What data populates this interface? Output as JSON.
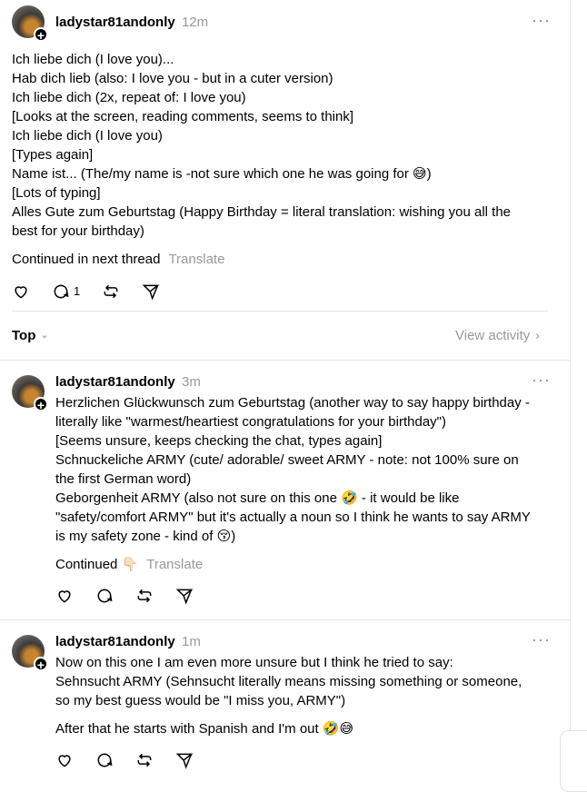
{
  "post": {
    "username": "ladystar81andonly",
    "time": "12m",
    "lines": [
      "Ich liebe dich (I love you)...",
      "Hab dich lieb (also: I love you - but in a cuter version)",
      "Ich liebe dich (2x, repeat of: I love you)",
      "[Looks at the screen, reading comments, seems to think]",
      "Ich liebe dich (I love you)",
      "[Types again]",
      "Name ist... (The/my name is -not sure which one he was going for 😅)",
      "[Lots of typing]",
      "Alles Gute zum Geburtstag (Happy Birthday = literal translation: wishing you all the",
      "best for your birthday)"
    ],
    "continued": "Continued in next thread",
    "translate": "Translate",
    "reply_count": "1"
  },
  "replies_header": {
    "sort_label": "Top",
    "view_activity": "View activity"
  },
  "reply1": {
    "username": "ladystar81andonly",
    "time": "3m",
    "lines": [
      "Herzlichen Glückwunsch zum Geburtstag (another way to say happy birthday -",
      "literally like \"warmest/heartiest congratulations for your birthday\")",
      "[Seems unsure, keeps checking the chat, types again]",
      "Schnuckeliche ARMY (cute/ adorable/ sweet ARMY - note: not 100% sure on",
      "the first German word)",
      "Geborgenheit ARMY (also not sure on this one 🤣 - it would be like",
      "\"safety/comfort ARMY\" but it's actually a noun so I think he wants to say ARMY",
      "is my safety zone - kind of 😚)"
    ],
    "continued": "Continued 👇🏻",
    "translate": "Translate"
  },
  "reply2": {
    "username": "ladystar81andonly",
    "time": "1m",
    "lines": [
      "Now on this one I am even more unsure but I think he tried to say:",
      "Sehnsucht ARMY (Sehnsucht literally means missing something or someone,",
      "so my best guess would be \"I miss you, ARMY\")"
    ],
    "closing": "After that he starts with Spanish and I'm out 🤣😅"
  },
  "icons": {
    "more": "more-options-icon",
    "like": "heart-icon",
    "reply": "comment-icon",
    "repost": "repost-icon",
    "share": "send-icon",
    "follow": "plus-icon"
  },
  "colors": {
    "text": "#000000",
    "muted": "#999999",
    "divider": "#e5e5e5"
  }
}
